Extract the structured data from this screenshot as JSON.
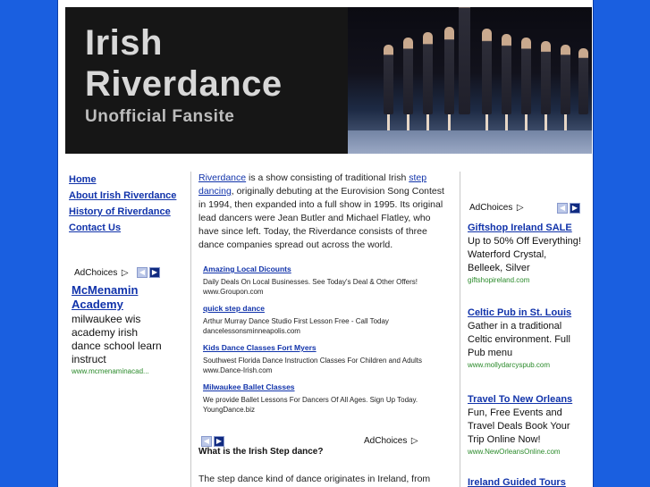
{
  "header": {
    "logo_line1": "Irish",
    "logo_line2": "Riverdance",
    "logo_line3": "Unofficial Fansite"
  },
  "nav": {
    "items": [
      "Home",
      "About Irish Riverdance",
      "History of Riverdance",
      "Contact Us"
    ]
  },
  "left_ad": {
    "adchoices": "AdChoices",
    "title": "McMenamin Academy",
    "body": "milwaukee wis academy irish dance school learn instruct",
    "url": "www.mcmenaminacad..."
  },
  "intro": {
    "link1": "Riverdance",
    "text1": " is a show consisting of traditional Irish ",
    "link2": "step dancing",
    "text2": ", originally debuting at the Eurovision Song Contest in 1994, then expanded into a full show in 1995. Its original lead dancers were Jean Butler and Michael Flatley, who have since left. Today, the Riverdance consists of three dance companies spread out across the world."
  },
  "center_links": [
    {
      "title": "Amazing Local Dicounts",
      "desc": "Daily Deals On Local Businesses. See Today's Deal & Other Offers!",
      "url": "www.Groupon.com"
    },
    {
      "title": "quick step dance",
      "desc": "Arthur Murray Dance Studio First Lesson Free - Call Today",
      "url": "dancelessonsminneapolis.com"
    },
    {
      "title": "Kids Dance Classes Fort Myers",
      "desc": "Southwest Florida Dance Instruction Classes For Children and Adults",
      "url": "www.Dance-Irish.com"
    },
    {
      "title": "Milwaukee Ballet Classes",
      "desc": "We provide Ballet Lessons For Dancers Of All Ages. Sign Up Today.",
      "url": "YoungDance.biz"
    }
  ],
  "center_adchoices": "AdChoices",
  "center_heading": "What is the Irish Step dance?",
  "center_para": "The step dance kind of dance originates in Ireland, from",
  "right_ads": {
    "adchoices": "AdChoices",
    "items": [
      {
        "title": "Giftshop Ireland SALE",
        "body": "Up to 50% Off Everything! Waterford Crystal, Belleek, Silver",
        "url": "giftshopireland.com"
      },
      {
        "title": "Celtic Pub in St. Louis",
        "body": "Gather in a traditional Celtic environment. Full Pub menu",
        "url": "www.mollydarcyspub.com"
      },
      {
        "title": "Travel To New Orleans",
        "body": "Fun, Free Events and Travel Deals Book Your Trip Online Now!",
        "url": "www.NewOrleansOnline.com"
      },
      {
        "title": "Ireland Guided Tours",
        "body": "",
        "url": ""
      }
    ]
  },
  "colors": {
    "background": "#1a5fe0",
    "link": "#1133aa",
    "ad_url": "#2a8a2a"
  }
}
